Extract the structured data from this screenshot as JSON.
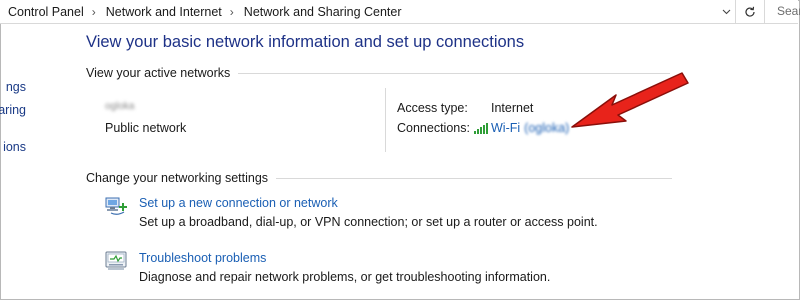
{
  "breadcrumb": {
    "items": [
      "Control Panel",
      "Network and Internet",
      "Network and Sharing Center"
    ]
  },
  "search": {
    "placeholder": "Searc"
  },
  "left_nav": {
    "items": [
      "ngs",
      "aring",
      "ions"
    ]
  },
  "page_title": "View your basic network information and set up connections",
  "active_networks": {
    "header": "View your active networks",
    "network_name": "ogloka",
    "network_type": "Public network",
    "access_type_label": "Access type:",
    "access_type_value": "Internet",
    "connections_label": "Connections:",
    "connection_name": "Wi-Fi",
    "connection_ssid": "(ogloka)"
  },
  "settings": {
    "header": "Change your networking settings",
    "tasks": [
      {
        "link": "Set up a new connection or network",
        "description": "Set up a broadband, dial-up, or VPN connection; or set up a router or access point.",
        "icon": "new-connection-icon"
      },
      {
        "link": "Troubleshoot problems",
        "description": "Diagnose and repair network problems, or get troubleshooting information.",
        "icon": "troubleshoot-icon"
      }
    ]
  },
  "colors": {
    "title": "#1e3287",
    "link": "#1a5fb4",
    "annotation_arrow": "#e8231b"
  }
}
